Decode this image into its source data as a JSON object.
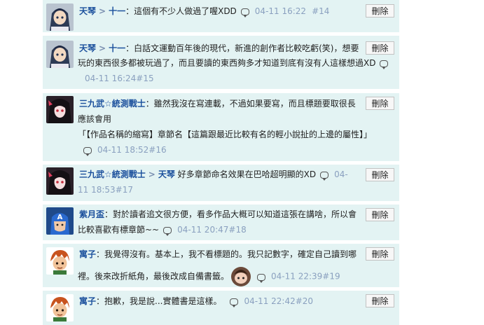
{
  "delete_label": "刪除",
  "comments": [
    {
      "user": "天琴",
      "reply_to": "十一",
      "lines": [
        "：這個有不少人做過了喔XDD"
      ],
      "time": "04-11 16:22",
      "num": "#14"
    },
    {
      "user": "天琴",
      "reply_to": "十一",
      "lines": [
        "：白話文運動百年後的現代，新進的創作者比較吃虧(笑)，想要",
        "玩的東西很多都被玩過了，而且要讀的東西夠多才知道到底有沒有人這樣想過XD"
      ],
      "time": "04-11 16:24",
      "num": "#15"
    },
    {
      "user": "三九武☆統測戰士",
      "lines": [
        "：雖然我沒在寫連載，不過如果要寫，而且標題要取很長",
        "應該會用",
        "「【作品名稱的縮寫】章節名【這篇跟最近比較有名的輕小說扯的上邊的屬性】」"
      ],
      "time": "04-11 18:52",
      "num": "#16"
    },
    {
      "user": "三九武☆統測戰士",
      "reply_to": "天琴",
      "lines": [
        "好多章節命名效果在巴哈超明顯的XD",
        "11 18:53"
      ],
      "time_prefix": "04-",
      "num": "#17"
    },
    {
      "user": "紫月盃",
      "lines": [
        "：對於讀者追文很方便，看多作品大概可以知道這張在講啥，所以會",
        "比較喜歡有標章節~~"
      ],
      "time": "04-11 20:47",
      "num": "#18"
    },
    {
      "user": "寓子",
      "lines": [
        "：我覺得沒有。基本上，我不看標題的。我只記數字，確定自己讀到哪",
        "裡。後來改折紙角，最後改成自備書籤。"
      ],
      "time": "04-11 22:39",
      "num": "#19"
    },
    {
      "user": "寓子",
      "lines": [
        "：抱歉，我是說...實體書是這樣。"
      ],
      "time": "04-11 22:42",
      "num": "#20"
    }
  ]
}
